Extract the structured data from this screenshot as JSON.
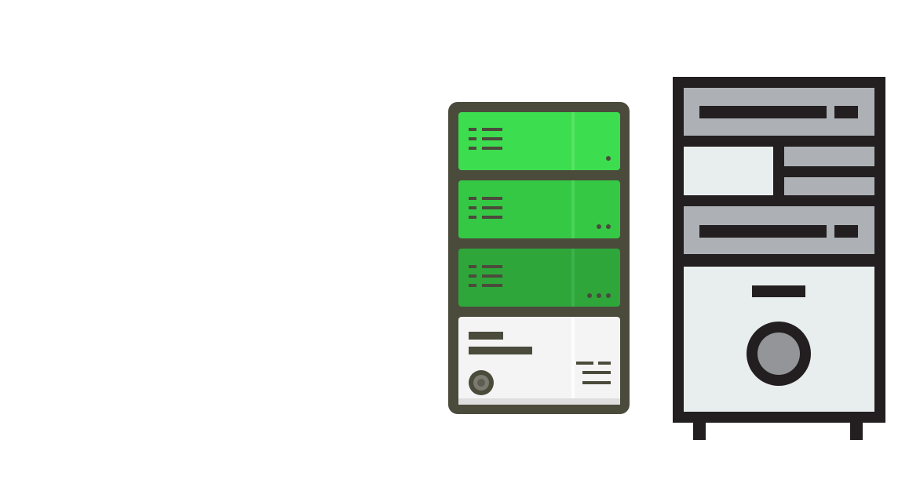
{
  "scene": {
    "background": "#ffffff",
    "icons": [
      {
        "name": "green-server-rack-icon",
        "colors": {
          "outline": "#4b4b3c",
          "drive_bay_1": "#3cdd4f",
          "drive_bay_2": "#35c845",
          "drive_bay_3": "#2ea63a",
          "front_panel": "#f4f4f4",
          "button": "#7a7a70"
        },
        "drive_bays": [
          {
            "indicator_dots": 1
          },
          {
            "indicator_dots": 2
          },
          {
            "indicator_dots": 3
          }
        ]
      },
      {
        "name": "gray-desktop-tower-icon",
        "colors": {
          "outline": "#231f20",
          "bay_fill": "#adb1b5",
          "panel_fill": "#e8eded",
          "power_button": "#939598"
        }
      }
    ]
  }
}
